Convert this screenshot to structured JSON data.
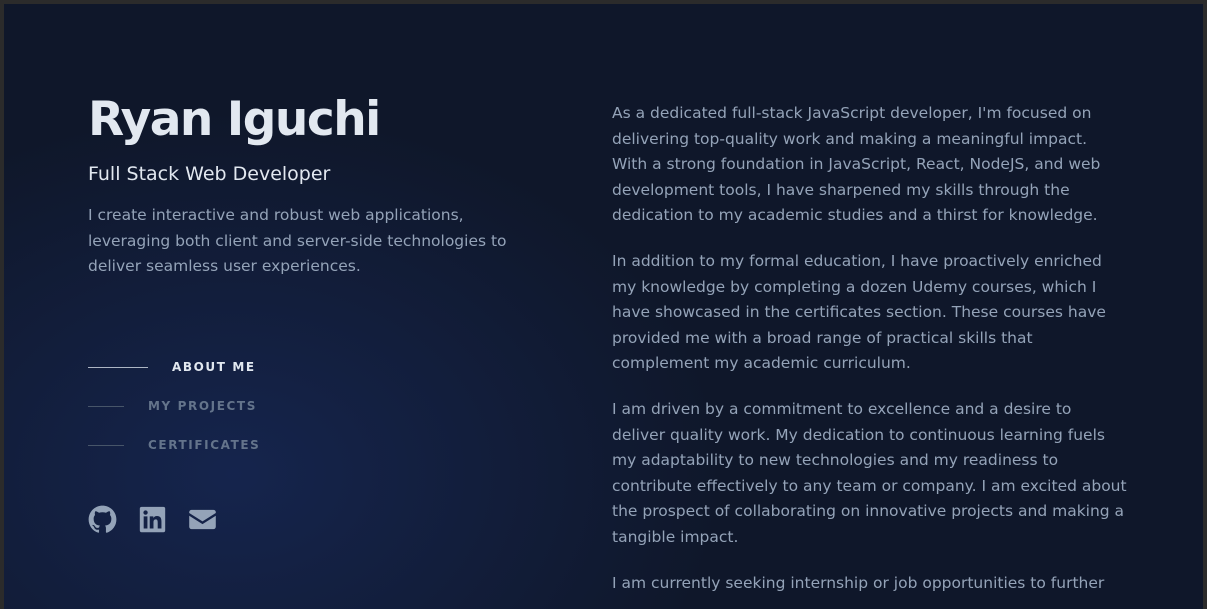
{
  "header": {
    "name": "Ryan Iguchi",
    "role": "Full Stack Web Developer",
    "tagline": "I create interactive and robust web applications, leveraging both client and server-side technologies to deliver seamless user experiences."
  },
  "nav": {
    "items": [
      {
        "label": "ABOUT ME",
        "active": true
      },
      {
        "label": "MY PROJECTS",
        "active": false
      },
      {
        "label": "CERTIFICATES",
        "active": false
      }
    ]
  },
  "socials": [
    {
      "icon": "github-icon"
    },
    {
      "icon": "linkedin-icon"
    },
    {
      "icon": "mail-icon"
    }
  ],
  "about": {
    "paragraphs": [
      "As a dedicated full-stack JavaScript developer, I'm focused on delivering top-quality work and making a meaningful impact. With a strong foundation in JavaScript, React, NodeJS, and web development tools, I have sharpened my skills through the dedication to my academic studies and a thirst for knowledge.",
      "In addition to my formal education, I have proactively enriched my knowledge by completing a dozen Udemy courses, which I have showcased in the certificates section. These courses have provided me with a broad range of practical skills that complement my academic curriculum.",
      "I am driven by a commitment to excellence and a desire to deliver quality work. My dedication to continuous learning fuels my adaptability to new technologies and my readiness to contribute effectively to any team or company. I am excited about the prospect of collaborating on innovative projects and making a tangible impact.",
      "I am currently seeking internship or job opportunities to further"
    ]
  },
  "colors": {
    "background": "#0f172a",
    "heading": "#e2e8f0",
    "body_text": "#94a3b8",
    "muted": "#64748b"
  }
}
